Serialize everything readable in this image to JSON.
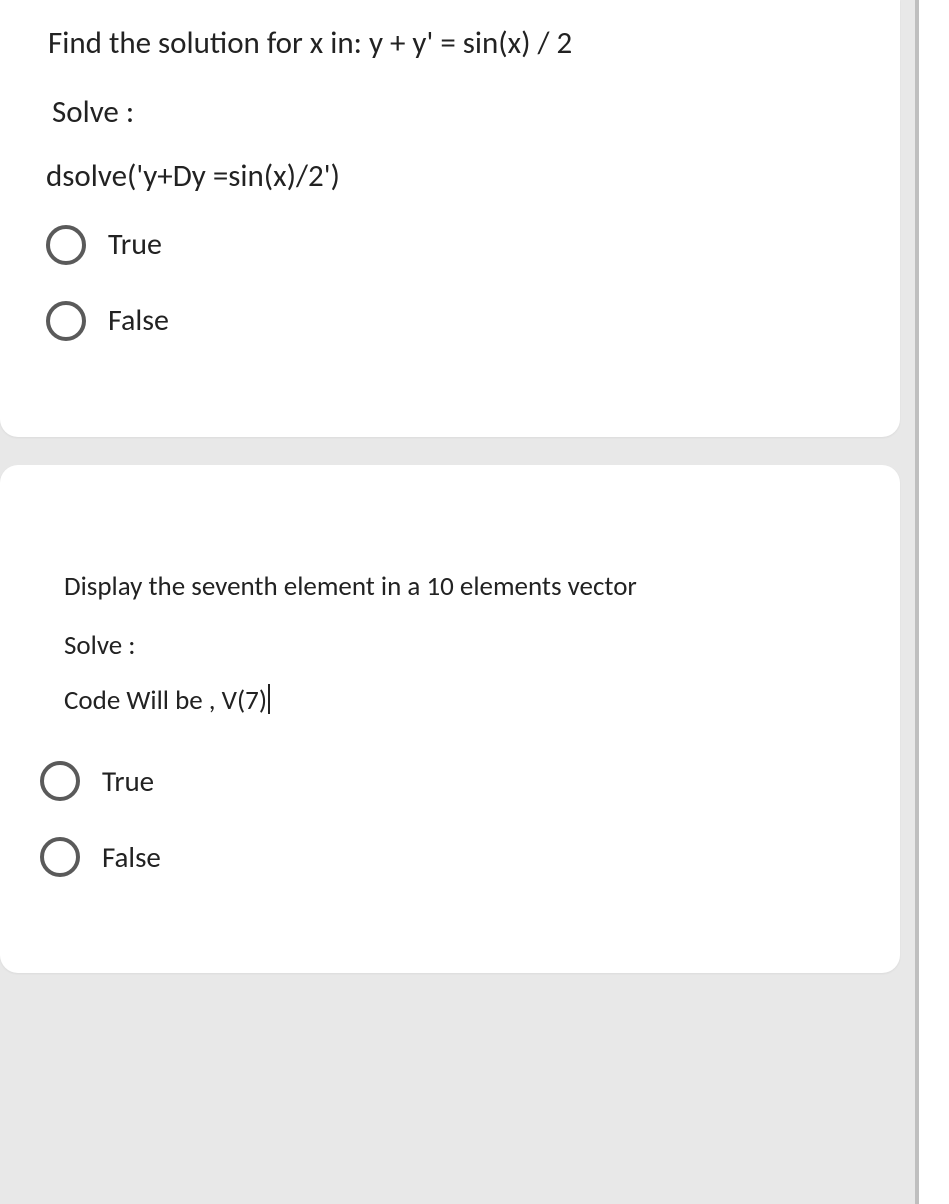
{
  "q1": {
    "prompt": "Find the solution for x in: y + y' = sin(x) / 2",
    "solve_label": "Solve :",
    "code": "dsolve('y+Dy =sin(x)/2')",
    "options": [
      {
        "label": "True"
      },
      {
        "label": "False"
      }
    ]
  },
  "q2": {
    "prompt": "Display the seventh element in a 10 elements vector",
    "solve_label": "Solve :",
    "code": "Code Will be ,  V(7)",
    "options": [
      {
        "label": "True"
      },
      {
        "label": "False"
      }
    ]
  }
}
